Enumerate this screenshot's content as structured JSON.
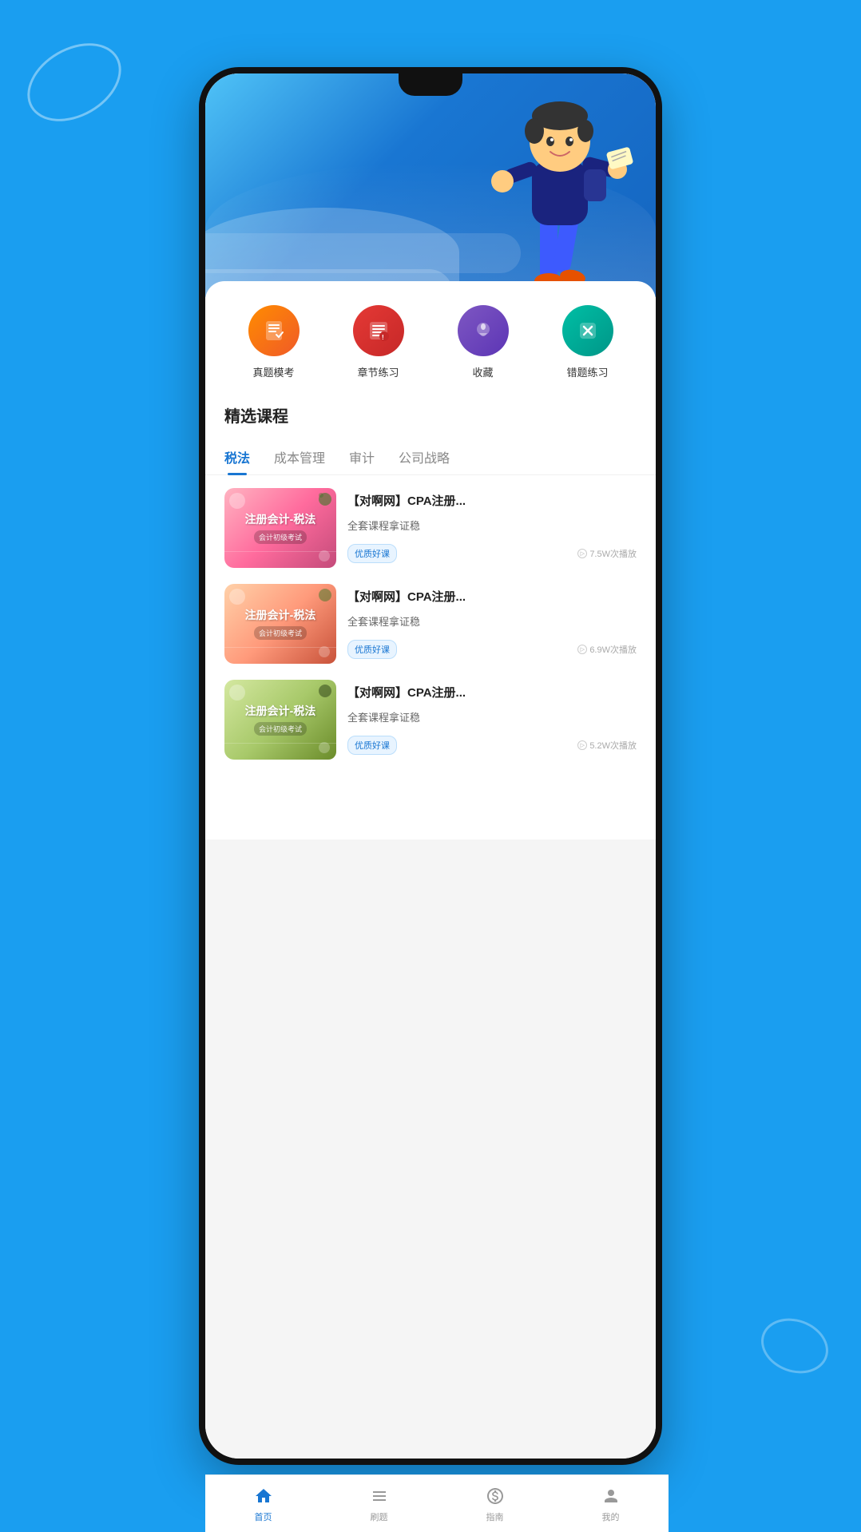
{
  "app": {
    "background_color": "#1a9ef0"
  },
  "quick_actions": [
    {
      "id": "zhenti",
      "label": "真题模考",
      "icon": "📝",
      "color_class": "orange"
    },
    {
      "id": "zhangji",
      "label": "章节练习",
      "icon": "📚",
      "color_class": "red"
    },
    {
      "id": "shoucang",
      "label": "收藏",
      "icon": "💡",
      "color_class": "purple"
    },
    {
      "id": "cuoti",
      "label": "错题练习",
      "icon": "✖",
      "color_class": "teal"
    }
  ],
  "section": {
    "title": "精选课程"
  },
  "tabs": [
    {
      "id": "shuifa",
      "label": "税法",
      "active": true
    },
    {
      "id": "chengben",
      "label": "成本管理",
      "active": false
    },
    {
      "id": "shenji",
      "label": "审计",
      "active": false
    },
    {
      "id": "gongsi",
      "label": "公司战略",
      "active": false
    }
  ],
  "courses": [
    {
      "id": 1,
      "title": "【对啊网】CPA注册...",
      "subtitle": "全套课程拿证稳",
      "badge": "优质好课",
      "play_count": "7.5W次播放",
      "thumb_title": "注册会计-税法",
      "thumb_subtitle": "会计初级考试",
      "thumb_class": "thumb-bg-1"
    },
    {
      "id": 2,
      "title": "【对啊网】CPA注册...",
      "subtitle": "全套课程拿证稳",
      "badge": "优质好课",
      "play_count": "6.9W次播放",
      "thumb_title": "注册会计-税法",
      "thumb_subtitle": "会计初级考试",
      "thumb_class": "thumb-bg-2"
    },
    {
      "id": 3,
      "title": "【对啊网】CPA注册...",
      "subtitle": "全套课程拿证稳",
      "badge": "优质好课",
      "play_count": "5.2W次播放",
      "thumb_title": "注册会计-税法",
      "thumb_subtitle": "会计初级考试",
      "thumb_class": "thumb-bg-3"
    }
  ],
  "bottom_nav": [
    {
      "id": "home",
      "label": "首页",
      "active": true,
      "icon": "🏠"
    },
    {
      "id": "practice",
      "label": "刷题",
      "active": false,
      "icon": "📋"
    },
    {
      "id": "guide",
      "label": "指南",
      "active": false,
      "icon": "🧭"
    },
    {
      "id": "profile",
      "label": "我的",
      "active": false,
      "icon": "👤"
    }
  ]
}
